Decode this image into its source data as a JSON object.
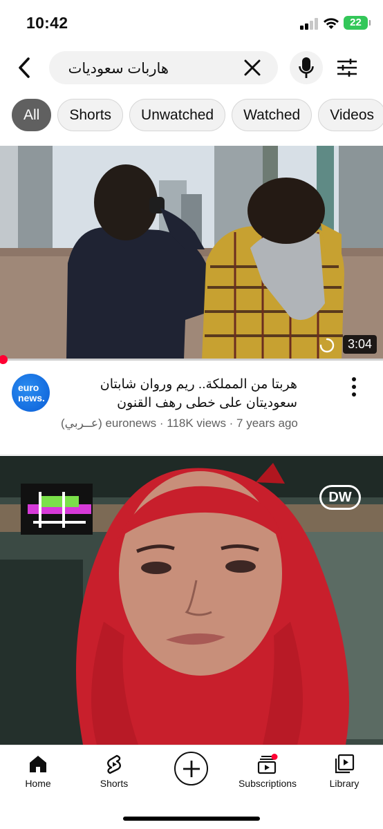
{
  "status_bar": {
    "time": "10:42",
    "battery": "22"
  },
  "search": {
    "query": "هاربات سعوديات"
  },
  "chips": [
    "All",
    "Shorts",
    "Unwatched",
    "Watched",
    "Videos"
  ],
  "videos": [
    {
      "duration": "3:04",
      "title": "هربتا من المملكة..  ريم وروان  شابتان سعوديتان على خطى رهف القنون",
      "meta": "(عــربي) euronews · 118K views · 7 years ago",
      "channel_avatar_text": "euro news."
    },
    {
      "overlay_badge": "DW"
    }
  ],
  "bottom_nav": {
    "home": "Home",
    "shorts": "Shorts",
    "subscriptions": "Subscriptions",
    "library": "Library"
  },
  "colors": {
    "accent_red": "#ff0033",
    "chip_active_bg": "#606060",
    "chip_bg": "#f2f2f2",
    "battery_green": "#33c759"
  }
}
